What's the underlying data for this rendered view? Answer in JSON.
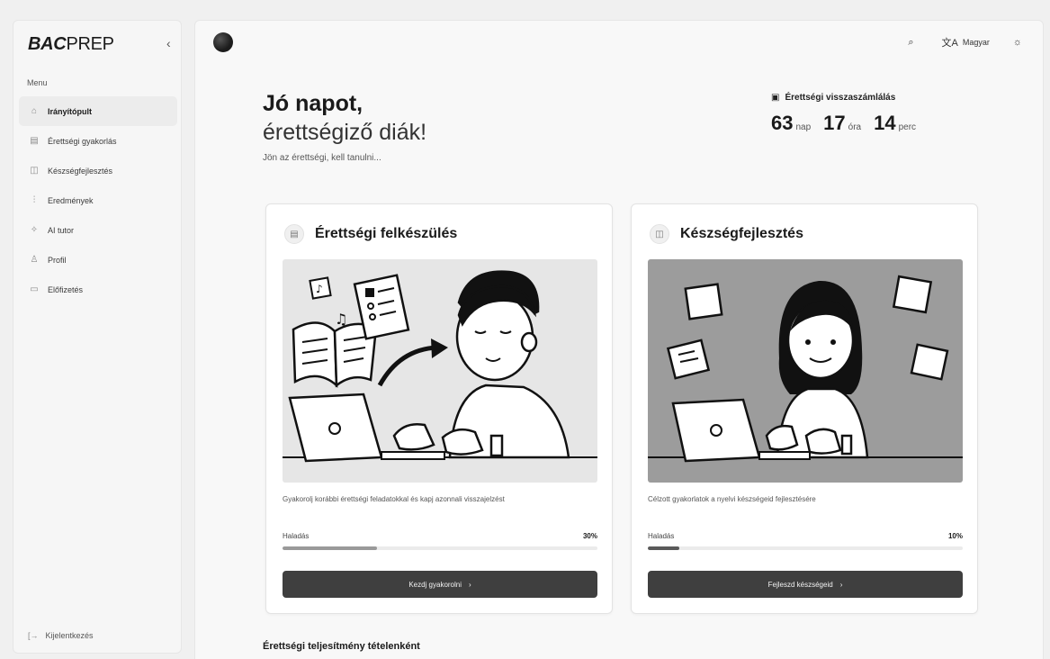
{
  "sidebar": {
    "brand_bold": "BAC",
    "brand_regular": "PREP",
    "collapse_glyph": "‹",
    "menu_heading": "Menu",
    "items": [
      {
        "label": "Irányítópult",
        "icon": "home-icon",
        "glyph": "⌂",
        "active": true
      },
      {
        "label": "Érettségi gyakorlás",
        "icon": "document-icon",
        "glyph": "▤",
        "active": false
      },
      {
        "label": "Készségfejlesztés",
        "icon": "book-icon",
        "glyph": "◫",
        "active": false
      },
      {
        "label": "Eredmények",
        "icon": "bar-chart-icon",
        "glyph": "⫶",
        "active": false
      },
      {
        "label": "AI tutor",
        "icon": "sparkles-icon",
        "glyph": "✧",
        "active": false
      },
      {
        "label": "Profil",
        "icon": "user-icon",
        "glyph": "♙",
        "active": false
      },
      {
        "label": "Előfizetés",
        "icon": "credit-card-icon",
        "glyph": "▭",
        "active": false
      }
    ],
    "logout_label": "Kijelentkezés",
    "logout_glyph": "[→"
  },
  "topbar": {
    "search_glyph": "⌕",
    "language_glyph": "文A",
    "language_label": "Magyar",
    "theme_glyph": "☼"
  },
  "greeting": {
    "line1": "Jó napot,",
    "line2": "érettségiző diák!",
    "subtitle": "Jön az érettségi, kell tanulni..."
  },
  "countdown": {
    "title": "Érettségi visszaszámlálás",
    "calendar_glyph": "▣",
    "days": "63",
    "days_unit": "nap",
    "hours": "17",
    "hours_unit": "óra",
    "minutes": "14",
    "minutes_unit": "perc"
  },
  "cards": [
    {
      "title": "Érettségi felkészülés",
      "icon": "document-icon",
      "glyph": "▤",
      "description": "Gyakorolj korábbi érettségi feladatokkal és kapj azonnali visszajelzést",
      "progress_label": "Haladás",
      "progress_pct": "30%",
      "progress_value": 30,
      "button_label": "Kezdj gyakorolni",
      "button_chevron": "›"
    },
    {
      "title": "Készségfejlesztés",
      "icon": "book-icon",
      "glyph": "◫",
      "description": "Célzott gyakorlatok a nyelvi készségeid fejlesztésére",
      "progress_label": "Haladás",
      "progress_pct": "10%",
      "progress_value": 10,
      "button_label": "Fejleszd készségeid",
      "button_chevron": "›"
    }
  ],
  "section_title": "Érettségi teljesítmény tételenként"
}
